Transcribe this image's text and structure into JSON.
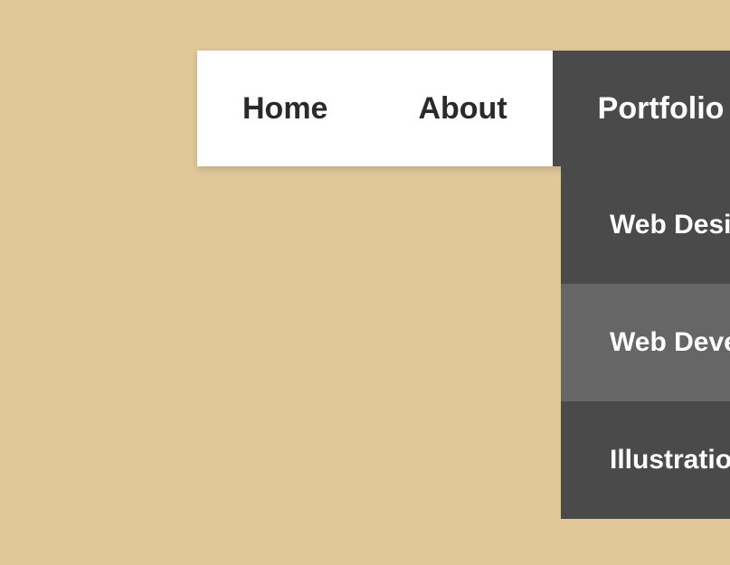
{
  "nav": {
    "items": [
      {
        "label": "Home",
        "active": false
      },
      {
        "label": "About",
        "active": false
      },
      {
        "label": "Portfolio",
        "active": true
      }
    ]
  },
  "dropdown": {
    "items": [
      {
        "label": "Web Design",
        "hover": false
      },
      {
        "label": "Web Development",
        "hover": true
      },
      {
        "label": "Illustrations",
        "hover": false
      }
    ]
  }
}
